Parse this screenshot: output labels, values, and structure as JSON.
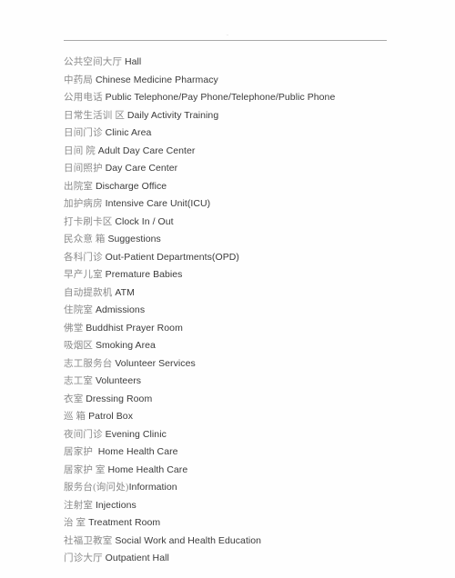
{
  "document": {
    "header_mark": "..",
    "entries": [
      {
        "cn": "公共空间大厅",
        "en": "Hall",
        "sep": " "
      },
      {
        "cn": "中药局",
        "en": "Chinese Medicine Pharmacy",
        "sep": " "
      },
      {
        "cn": "公用电话",
        "en": "Public Telephone/Pay Phone/Telephone/Public Phone",
        "sep": " "
      },
      {
        "cn": "日常生活训 区",
        "en": "Daily Activity Training",
        "sep": " "
      },
      {
        "cn": "日间门诊",
        "en": "Clinic Area",
        "sep": " "
      },
      {
        "cn": "日间 院",
        "en": "Adult Day Care Center",
        "sep": " "
      },
      {
        "cn": "日间照护",
        "en": "Day Care Center",
        "sep": " "
      },
      {
        "cn": "出院室",
        "en": "Discharge Office",
        "sep": " "
      },
      {
        "cn": "加护病房",
        "en": "Intensive Care Unit(ICU)",
        "sep": " "
      },
      {
        "cn": "打卡刷卡区",
        "en": "Clock In / Out",
        "sep": " "
      },
      {
        "cn": "民众意 箱",
        "en": "Suggestions",
        "sep": " "
      },
      {
        "cn": "各科门诊",
        "en": "Out-Patient Departments(OPD)",
        "sep": " "
      },
      {
        "cn": "早产儿室",
        "en": "Premature Babies",
        "sep": " "
      },
      {
        "cn": "自动提款机",
        "en": "ATM",
        "sep": " "
      },
      {
        "cn": "住院室",
        "en": "Admissions",
        "sep": " "
      },
      {
        "cn": "佛堂",
        "en": "Buddhist Prayer Room",
        "sep": " "
      },
      {
        "cn": "吸烟区",
        "en": "Smoking Area",
        "sep": " "
      },
      {
        "cn": "志工服务台",
        "en": "Volunteer Services",
        "sep": " "
      },
      {
        "cn": "志工室",
        "en": "Volunteers",
        "sep": " "
      },
      {
        "cn": "衣室",
        "en": "Dressing Room",
        "sep": " "
      },
      {
        "cn": "巡 箱",
        "en": "Patrol Box",
        "sep": " "
      },
      {
        "cn": "夜间门诊",
        "en": "Evening Clinic",
        "sep": " "
      },
      {
        "cn": "居家护",
        "en": "Home Health Care",
        "sep": "  "
      },
      {
        "cn": "居家护 室",
        "en": "Home Health Care",
        "sep": " "
      },
      {
        "cn": "服务台(询问处)",
        "en": "Information",
        "sep": ""
      },
      {
        "cn": "注射室",
        "en": "Injections",
        "sep": " "
      },
      {
        "cn": "治 室",
        "en": "Treatment Room",
        "sep": " "
      },
      {
        "cn": "社福卫教室",
        "en": "Social Work and Health Education",
        "sep": " "
      },
      {
        "cn": "门诊大厅",
        "en": "Outpatient Hall",
        "sep": " "
      }
    ]
  }
}
